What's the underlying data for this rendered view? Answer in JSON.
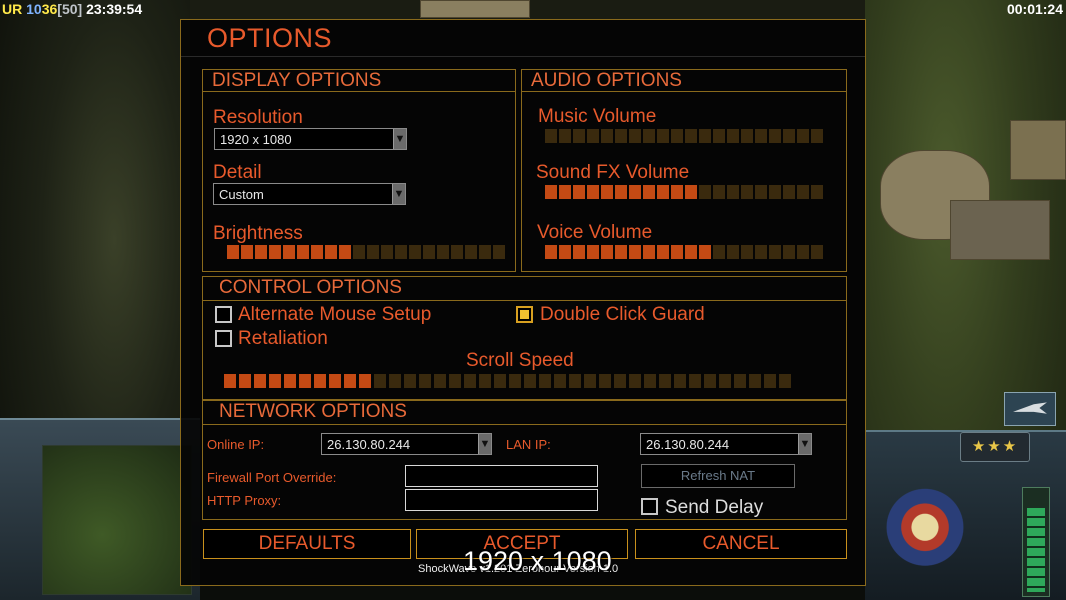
{
  "overlay": {
    "status_ur": "UR",
    "status_n1": "10",
    "status_n2": "36",
    "status_n3": "[50]",
    "clock": "23:39:54",
    "timer": "00:01:24",
    "rank_stars": "★★★"
  },
  "dialog": {
    "title": "OPTIONS"
  },
  "display": {
    "title": "DISPLAY OPTIONS",
    "resolution_label": "Resolution",
    "resolution_value": "1920 x 1080",
    "detail_label": "Detail",
    "detail_value": "Custom",
    "brightness_label": "Brightness",
    "brightness_level": 9,
    "brightness_max": 20
  },
  "audio": {
    "title": "AUDIO OPTIONS",
    "music_label": "Music Volume",
    "music_level": 0,
    "music_max": 20,
    "sfx_label": "Sound FX Volume",
    "sfx_level": 11,
    "sfx_max": 20,
    "voice_label": "Voice Volume",
    "voice_level": 12,
    "voice_max": 20
  },
  "control": {
    "title": "CONTROL OPTIONS",
    "alt_mouse_label": "Alternate Mouse Setup",
    "alt_mouse_checked": false,
    "double_click_label": "Double Click Guard",
    "double_click_checked": true,
    "retaliation_label": "Retaliation",
    "retaliation_checked": false,
    "scroll_label": "Scroll Speed",
    "scroll_level": 10,
    "scroll_max": 38
  },
  "network": {
    "title": "NETWORK OPTIONS",
    "online_ip_label": "Online IP:",
    "online_ip_value": "26.130.80.244",
    "lan_ip_label": "LAN IP:",
    "lan_ip_value": "26.130.80.244",
    "firewall_label": "Firewall Port Override:",
    "firewall_value": "",
    "http_proxy_label": "HTTP Proxy:",
    "http_proxy_value": "",
    "refresh_nat_label": "Refresh NAT",
    "send_delay_label": "Send Delay",
    "send_delay_checked": false
  },
  "buttons": {
    "defaults": "DEFAULTS",
    "accept": "ACCEPT",
    "cancel": "CANCEL"
  },
  "footer": {
    "version": "ShockWave v1.201 Zerohour Version 1.0",
    "resolution_overlay": "1920 x 1080"
  },
  "colors": {
    "accent_orange": "#e85a2c",
    "frame_gold": "#8a6a1c",
    "slider_on": "#c44a14",
    "slider_off": "#3a2a0e"
  }
}
